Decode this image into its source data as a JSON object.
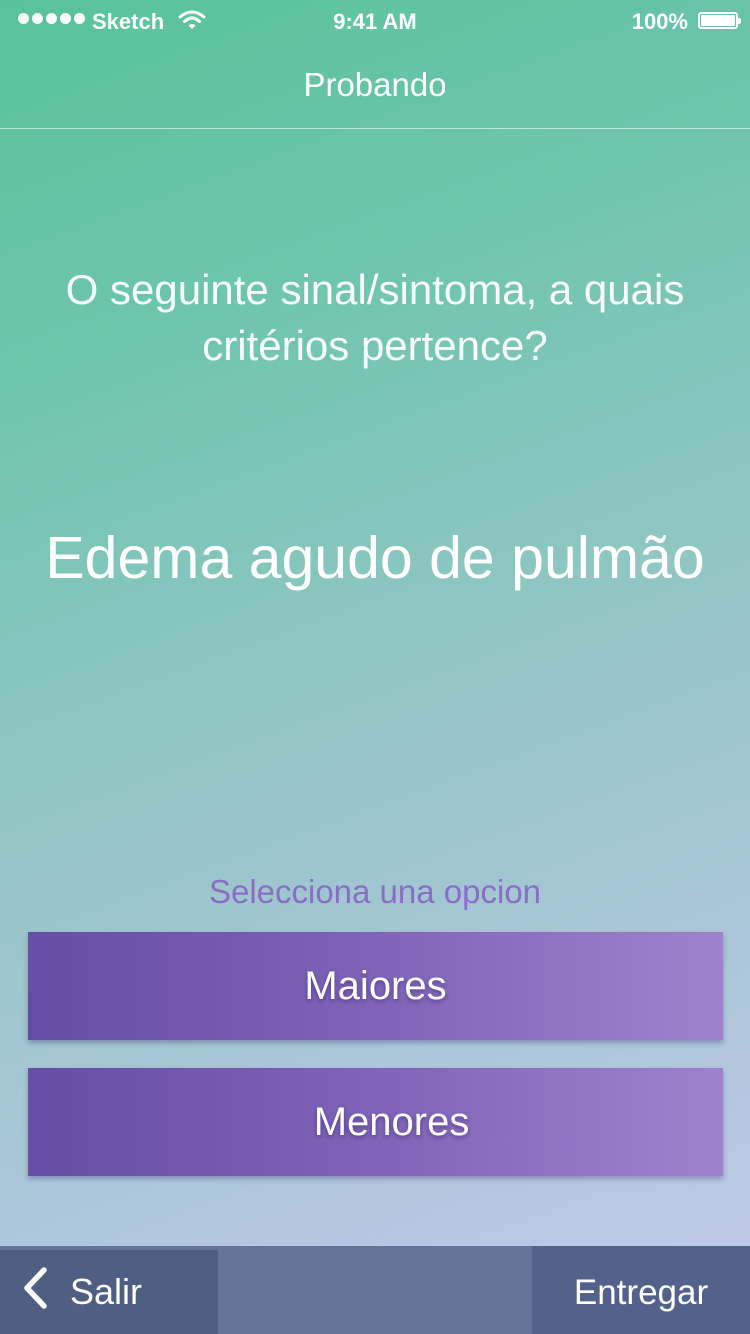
{
  "status_bar": {
    "carrier": "Sketch",
    "time": "9:41 AM",
    "battery": "100%",
    "signal_dots": 5,
    "battery_level": 1.0,
    "icons": [
      "signal-dots-icon",
      "wifi-icon",
      "battery-icon"
    ]
  },
  "nav": {
    "title": "Probando"
  },
  "quiz": {
    "question": "O seguinte sinal/sintoma, a quais critérios pertence?",
    "term": "Edema agudo de pulmão",
    "prompt": "Selecciona una opcion",
    "options": [
      {
        "label": "Maiores"
      },
      {
        "label": "Menores"
      }
    ]
  },
  "footer": {
    "exit_label": "Salir",
    "exit_icon": "chevron-left-icon",
    "submit_label": "Entregar"
  },
  "colors": {
    "bg_start": "#58c39a",
    "bg_end": "#c2c8ea",
    "option_start": "#654ea5",
    "option_end": "#9e82cd",
    "prompt": "#8b6cc9",
    "footer": "#64759a",
    "footer_button": "#4f5f84"
  }
}
